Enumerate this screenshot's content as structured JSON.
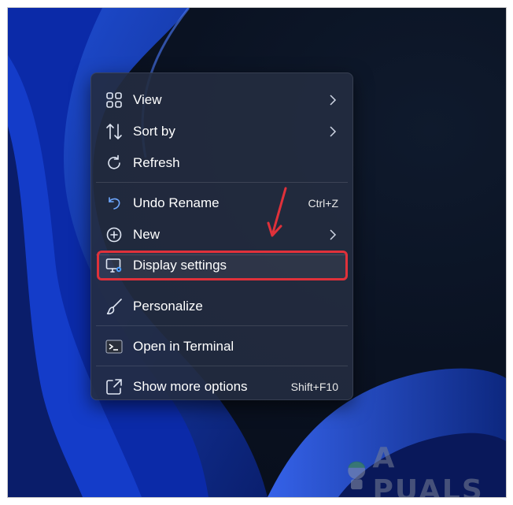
{
  "menu": {
    "items": [
      {
        "label": "View",
        "icon": "view-grid-icon",
        "submenu": true
      },
      {
        "label": "Sort by",
        "icon": "sort-arrows-icon",
        "submenu": true
      },
      {
        "label": "Refresh",
        "icon": "refresh-icon"
      },
      {
        "label": "Undo Rename",
        "icon": "undo-icon",
        "shortcut": "Ctrl+Z"
      },
      {
        "label": "New",
        "icon": "plus-circle-icon",
        "submenu": true
      },
      {
        "label": "Display settings",
        "icon": "display-settings-icon",
        "highlighted": true
      },
      {
        "label": "Personalize",
        "icon": "brush-icon"
      },
      {
        "label": "Open in Terminal",
        "icon": "terminal-icon"
      },
      {
        "label": "Show more options",
        "icon": "show-more-icon",
        "shortcut": "Shift+F10"
      }
    ]
  },
  "annotation": {
    "highlight_color": "#e0313a",
    "arrow": "red-arrow-icon"
  },
  "watermark": {
    "text": "A PUALS",
    "logo": "appuals-mascot-icon"
  }
}
